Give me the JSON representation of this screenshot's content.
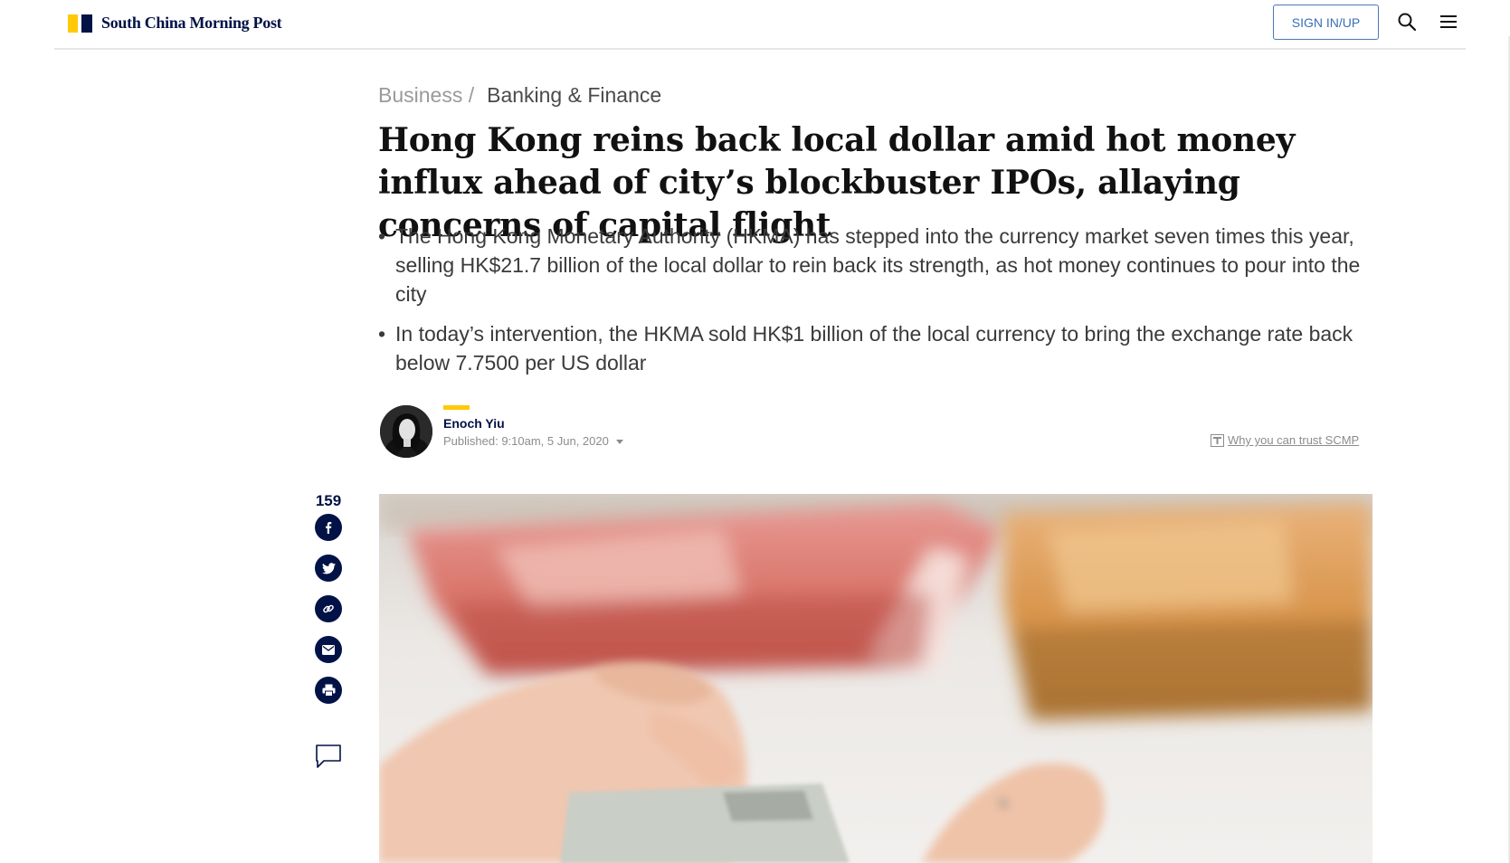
{
  "header": {
    "brand": "South China Morning Post",
    "signin_label": "SIGN IN/UP",
    "icons": {
      "search": "search-icon",
      "menu": "hamburger-menu-icon"
    },
    "colors": {
      "brand_yellow": "#ffca05",
      "brand_navy": "#001246",
      "signin_blue": "#3a6fb8"
    }
  },
  "breadcrumb": {
    "parent": "Business",
    "separator": "/",
    "current": "Banking & Finance"
  },
  "article": {
    "headline": "Hong Kong reins back local dollar amid hot money influx ahead of city’s blockbuster IPOs, allaying concerns of capital flight",
    "summary": [
      {
        "bullet": "•",
        "text": "The Hong Kong Monetary Authority (HKMA) has stepped into the currency market seven times this year, selling HK$21.7 billion of the local dollar to rein back its strength, as hot money continues to pour into the city"
      },
      {
        "bullet": "•",
        "text": "In today’s intervention, the HKMA sold HK$1 billion of the local currency to bring the exchange rate back below 7.7500 per US dollar"
      }
    ]
  },
  "byline": {
    "author": "Enoch Yiu",
    "published": "Published: 9:10am, 5 Jun, 2020",
    "trust_link": "Why you can trust SCMP"
  },
  "share": {
    "count": "159",
    "buttons": [
      "facebook-icon",
      "twitter-icon",
      "link-icon",
      "email-icon",
      "print-icon"
    ],
    "comment_icon": "comment-icon"
  }
}
